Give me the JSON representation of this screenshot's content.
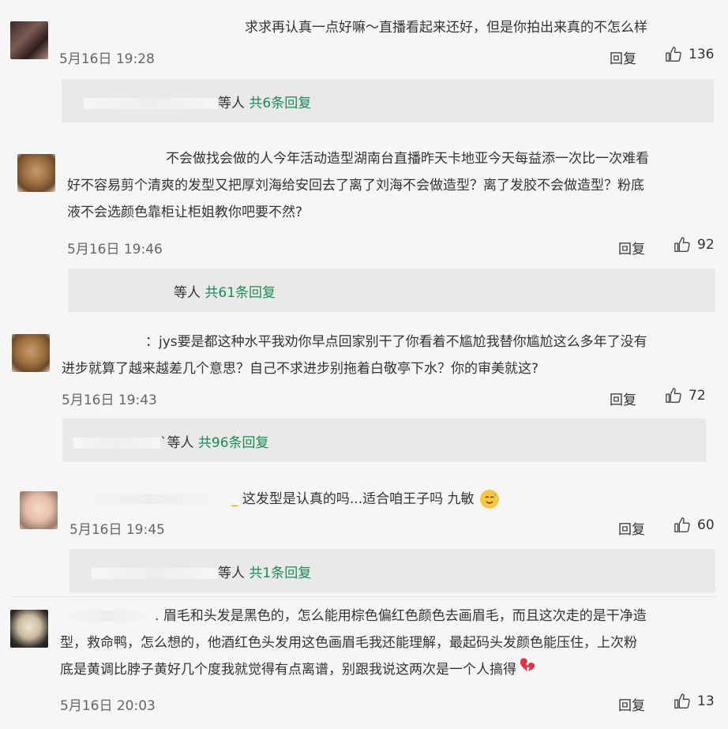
{
  "comments": [
    {
      "text": "求求再认真一点好嘛～直播看起来还好，但是你拍出来真的不怎么样",
      "date": "5月16日 19:28",
      "reply_label": "回复",
      "likes": "136",
      "sub_suffix": "等人",
      "sub_count": "共6条回复"
    },
    {
      "line1": "不会做找会做的人今年活动造型湖南台直播昨天卡地亚今天每益添一次比一次难看",
      "line2": "好不容易剪个清爽的发型又把厚刘海给安回去了离了刘海不会做造型？离了发胶不会做造型？粉底",
      "line3": "液不会选颜色靠柜让柜姐教你吧要不然?",
      "date": "5月16日 19:46",
      "reply_label": "回复",
      "likes": "92",
      "sub_suffix": "等人",
      "sub_count": "共61条回复"
    },
    {
      "line1": "：jys要是都这种水平我劝你早点回家别干了你看着不尴尬我替你尴尬这么多年了没有",
      "line2": "进步就算了越来越差几个意思？自己不求进步别拖着白敬亭下水？你的审美就这?",
      "date": "5月16日 19:43",
      "reply_label": "回复",
      "likes": "72",
      "sub_suffix": "`等人",
      "sub_count": "共96条回复"
    },
    {
      "text": "这发型是认真的吗...适合咱王子吗 九敏",
      "date": "5月16日 19:45",
      "reply_label": "回复",
      "likes": "60",
      "sub_suffix": "等人",
      "sub_count": "共1条回复"
    },
    {
      "line1": "眉毛和头发是黑色的，怎么能用棕色偏红色颜色去画眉毛，而且这次走的是干净造",
      "line2": "型，救命鸭，怎么想的，他酒红色头发用这色画眉毛我还能理解，最起码头发颜色能压住，上次粉",
      "line3": "底是黄调比脖子黄好几个度我就觉得有点离谱，别跟我说这两次是一个人搞得",
      "date": "5月16日 20:03",
      "reply_label": "回复",
      "likes": "13"
    }
  ],
  "icons": {
    "like": "thumbs-up-icon",
    "emoji_sweat": "sweat-smile-emoji-icon",
    "emoji_heart": "broken-heart-emoji-icon"
  },
  "colors": {
    "background": "#f6f6f6",
    "subpanel": "#e9e9e9",
    "reply_count": "#1a8a5a"
  }
}
